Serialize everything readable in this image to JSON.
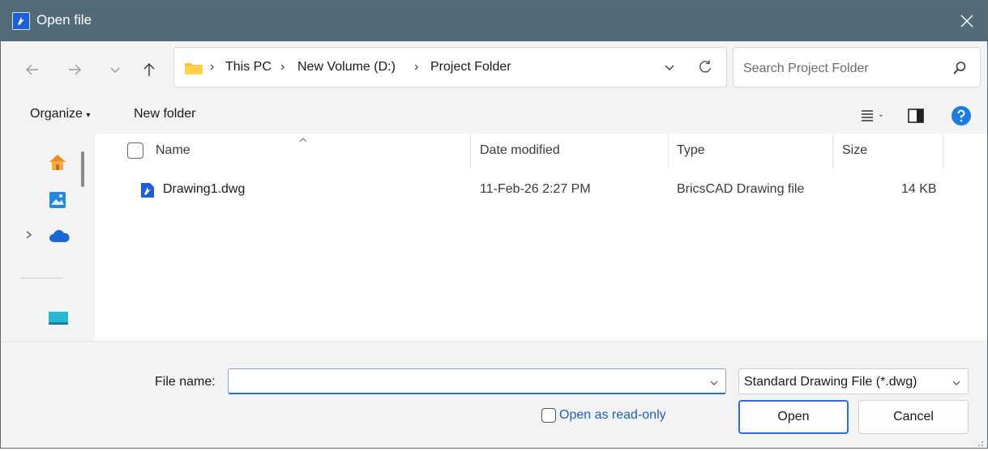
{
  "window": {
    "title": "Open file"
  },
  "nav": {
    "breadcrumb": [
      "This PC",
      "New Volume (D:)",
      "Project Folder"
    ],
    "breadcrumb_sep": "›",
    "search_placeholder": "Search Project Folder"
  },
  "commands": {
    "organize": "Organize",
    "new_folder": "New folder"
  },
  "columns": {
    "name": "Name",
    "date_modified": "Date modified",
    "type": "Type",
    "size": "Size"
  },
  "files": [
    {
      "name": "Drawing1.dwg",
      "date_modified": "11-Feb-26 2:27 PM",
      "type": "BricsCAD Drawing file",
      "size": "14 KB"
    }
  ],
  "bottom": {
    "file_name_label": "File name:",
    "file_name_value": "",
    "filter": "Standard Drawing File (*.dwg)",
    "read_only_label": "Open as read-only",
    "open_label": "Open",
    "cancel_label": "Cancel"
  },
  "colors": {
    "titlebar": "#536b77",
    "accent": "#2a6fd6",
    "link": "#1b5fbf",
    "help": "#1e7be0"
  }
}
